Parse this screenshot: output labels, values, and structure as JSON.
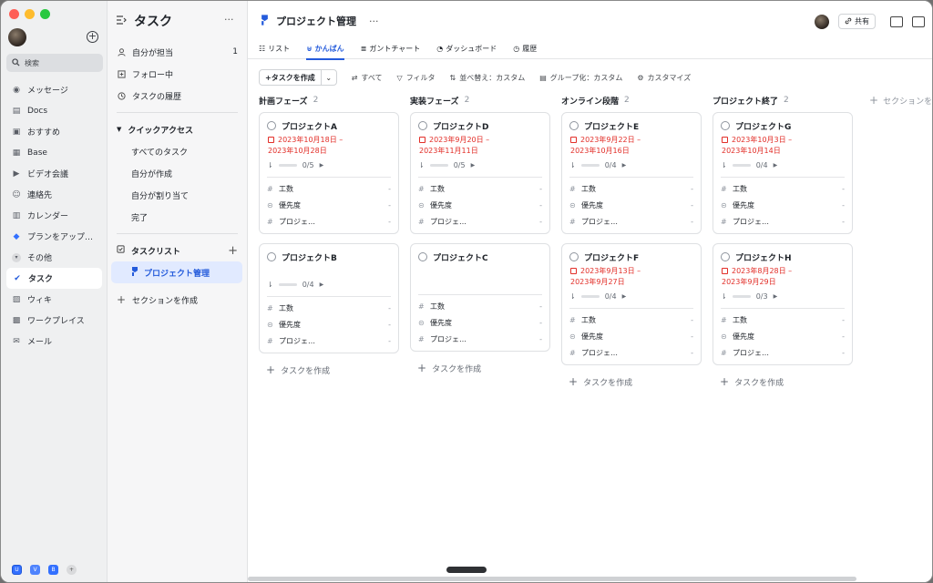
{
  "colors": {
    "accent": "#245bdb",
    "date_red": "#e22e28",
    "mac_red": "#fe5f57",
    "mac_yellow": "#febc2e",
    "mac_green": "#28c840"
  },
  "nav": {
    "search": "検索",
    "items": [
      {
        "label": "メッセージ",
        "icon": "chat-icon"
      },
      {
        "label": "Docs",
        "icon": "docs-icon"
      },
      {
        "label": "おすすめ",
        "icon": "recommend-icon"
      },
      {
        "label": "Base",
        "icon": "base-icon"
      },
      {
        "label": "ビデオ会議",
        "icon": "video-icon"
      },
      {
        "label": "連絡先",
        "icon": "contacts-icon"
      },
      {
        "label": "カレンダー",
        "icon": "calendar-icon"
      },
      {
        "label": "プランをアップ…",
        "icon": "diamond-icon"
      },
      {
        "label": "その他",
        "icon": "collapse-icon"
      },
      {
        "label": "タスク",
        "icon": "task-check-icon"
      },
      {
        "label": "ウィキ",
        "icon": "wiki-icon"
      },
      {
        "label": "ワークプレイス",
        "icon": "workplace-icon"
      },
      {
        "label": "メール",
        "icon": "mail-icon"
      }
    ],
    "bottom": [
      "U",
      "V",
      "B",
      "+"
    ]
  },
  "tasknav": {
    "title": "タスク",
    "items": [
      {
        "label": "自分が担当",
        "count": "1"
      },
      {
        "label": "フォロー中"
      },
      {
        "label": "タスクの履歴"
      }
    ],
    "quick": "クイックアクセス",
    "quick_items": [
      "すべてのタスク",
      "自分が作成",
      "自分が割り当て",
      "完了"
    ],
    "tasklist": "タスクリスト",
    "active": "プロジェクト管理",
    "create_section": "セクションを作成"
  },
  "main": {
    "title": "プロジェクト管理",
    "share": "共有",
    "tabs": [
      "リスト",
      "かんばん",
      "ガントチャート",
      "ダッシュボード",
      "履歴"
    ],
    "toolbar": {
      "create": "タスクを作成",
      "all": "すべて",
      "filter": "フィルタ",
      "sort": "並べ替え：カスタム",
      "group": "グループ化：カスタム",
      "customize": "カスタマイズ"
    },
    "add_section": "セクションを",
    "add_task": "タスクを作成",
    "field_labels": [
      "工数",
      "優先度",
      "プロジェ…"
    ],
    "field_value": "-"
  },
  "columns": [
    {
      "name": "計画フェーズ",
      "count": "2",
      "cards": [
        {
          "title": "プロジェクトA",
          "date1": "2023年10月18日 –",
          "date2": "2023年10月28日",
          "progress": "0/5"
        },
        {
          "title": "プロジェクトB",
          "date1": "",
          "date2": "",
          "progress": "0/4"
        }
      ]
    },
    {
      "name": "実装フェーズ",
      "count": "2",
      "cards": [
        {
          "title": "プロジェクトD",
          "date1": "2023年9月20日 –",
          "date2": "2023年11月11日",
          "progress": "0/5"
        },
        {
          "title": "プロジェクトC",
          "date1": "",
          "date2": "",
          "progress": ""
        }
      ]
    },
    {
      "name": "オンライン段階",
      "count": "2",
      "cards": [
        {
          "title": "プロジェクトE",
          "date1": "2023年9月22日 –",
          "date2": "2023年10月16日",
          "progress": "0/4"
        },
        {
          "title": "プロジェクトF",
          "date1": "2023年9月13日 –",
          "date2": "2023年9月27日",
          "progress": "0/4"
        }
      ]
    },
    {
      "name": "プロジェクト終了",
      "count": "2",
      "cards": [
        {
          "title": "プロジェクトG",
          "date1": "2023年10月3日 –",
          "date2": "2023年10月14日",
          "progress": "0/4"
        },
        {
          "title": "プロジェクトH",
          "date1": "2023年8月28日 –",
          "date2": "2023年9月29日",
          "progress": "0/3"
        }
      ]
    }
  ]
}
